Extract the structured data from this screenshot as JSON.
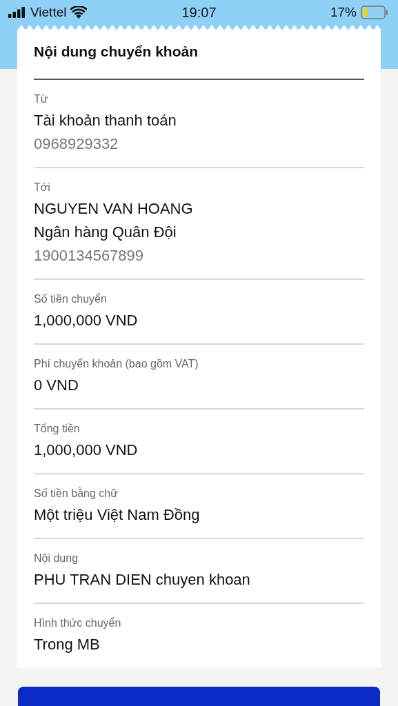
{
  "status_bar": {
    "carrier": "Viettel",
    "time": "19:07",
    "battery": "17%"
  },
  "title": "Nội dung chuyển khoản",
  "sections": [
    {
      "label": "Từ",
      "lines": [
        {
          "kind": "primary",
          "text": "Tài khoản thanh toán"
        },
        {
          "kind": "secondary",
          "text": "0968929332"
        }
      ]
    },
    {
      "label": "Tới",
      "lines": [
        {
          "kind": "primary",
          "text": "NGUYEN VAN HOANG"
        },
        {
          "kind": "primary",
          "text": "Ngân hàng Quân Đội"
        },
        {
          "kind": "secondary",
          "text": "1900134567899"
        }
      ]
    },
    {
      "label": "Số tiền chuyển",
      "lines": [
        {
          "kind": "primary",
          "text": "1,000,000 VND"
        }
      ]
    },
    {
      "label": "Phí chuyển khoản (bao gồm VAT)",
      "lines": [
        {
          "kind": "primary",
          "text": "0 VND"
        }
      ]
    },
    {
      "label": "Tổng tiền",
      "lines": [
        {
          "kind": "primary",
          "text": "1,000,000 VND"
        }
      ]
    },
    {
      "label": "Số tiền bằng chữ",
      "lines": [
        {
          "kind": "primary",
          "text": "Một triệu Việt Nam Đồng"
        }
      ]
    },
    {
      "label": "Nội dung",
      "lines": [
        {
          "kind": "primary",
          "text": "PHU TRAN DIEN chuyen khoan"
        }
      ]
    },
    {
      "label": "Hình thức chuyển",
      "lines": [
        {
          "kind": "primary",
          "text": "Trong MB"
        }
      ]
    }
  ]
}
